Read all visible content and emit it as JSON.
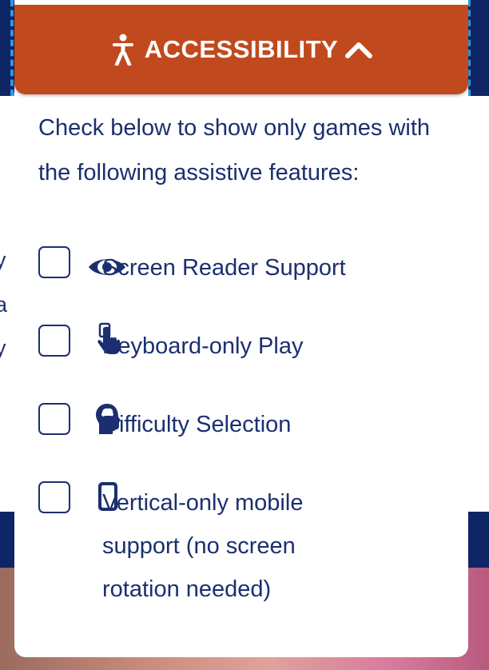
{
  "header": {
    "title": "ACCESSIBILITY"
  },
  "intro_text": "Check below to show only games with the following assistive features:",
  "options": [
    {
      "label": "Screen Reader Support",
      "icon": "eye-icon",
      "checked": false
    },
    {
      "label": "Keyboard-only Play",
      "icon": "pointer-hand-icon",
      "checked": false
    },
    {
      "label": "Difficulty Selection",
      "icon": "head-brain-icon",
      "checked": false
    },
    {
      "label_lines": [
        "Vertical-only mobile",
        "support (no screen",
        "rotation needed)"
      ],
      "icon": "mobile-phone-icon",
      "checked": false
    }
  ],
  "background_fragments": [
    "y",
    "a",
    "y"
  ],
  "colors": {
    "accent": "#c0491d",
    "navy": "#0e2566",
    "text": "#1b2f70",
    "focus": "#2d9be0"
  }
}
